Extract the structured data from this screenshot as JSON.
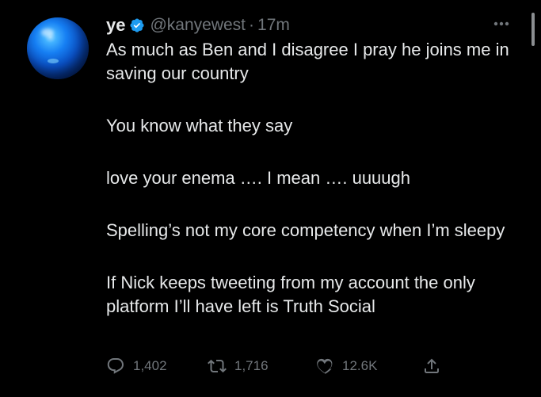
{
  "tweet": {
    "author_name": "ye",
    "handle": "@kanyewest",
    "separator": "·",
    "time": "17m",
    "text": [
      "As much as Ben and I disagree I pray he joins me in saving our country",
      "You know what they say",
      "love your enema …. I mean …. uuuugh",
      "Spelling’s not my core competency when I’m sleepy",
      "If Nick keeps tweeting from my account the only platform I’ll have left is Truth Social"
    ]
  },
  "actions": {
    "replies": "1,402",
    "retweets": "1,716",
    "likes": "12.6K"
  },
  "icons": {
    "verified": "verified-badge-icon",
    "more": "more-icon",
    "reply": "reply-icon",
    "retweet": "retweet-icon",
    "like": "heart-icon",
    "share": "share-icon"
  },
  "colors": {
    "background": "#000000",
    "text": "#e7e9ea",
    "secondary": "#71767b",
    "verified": "#1d9bf0"
  }
}
